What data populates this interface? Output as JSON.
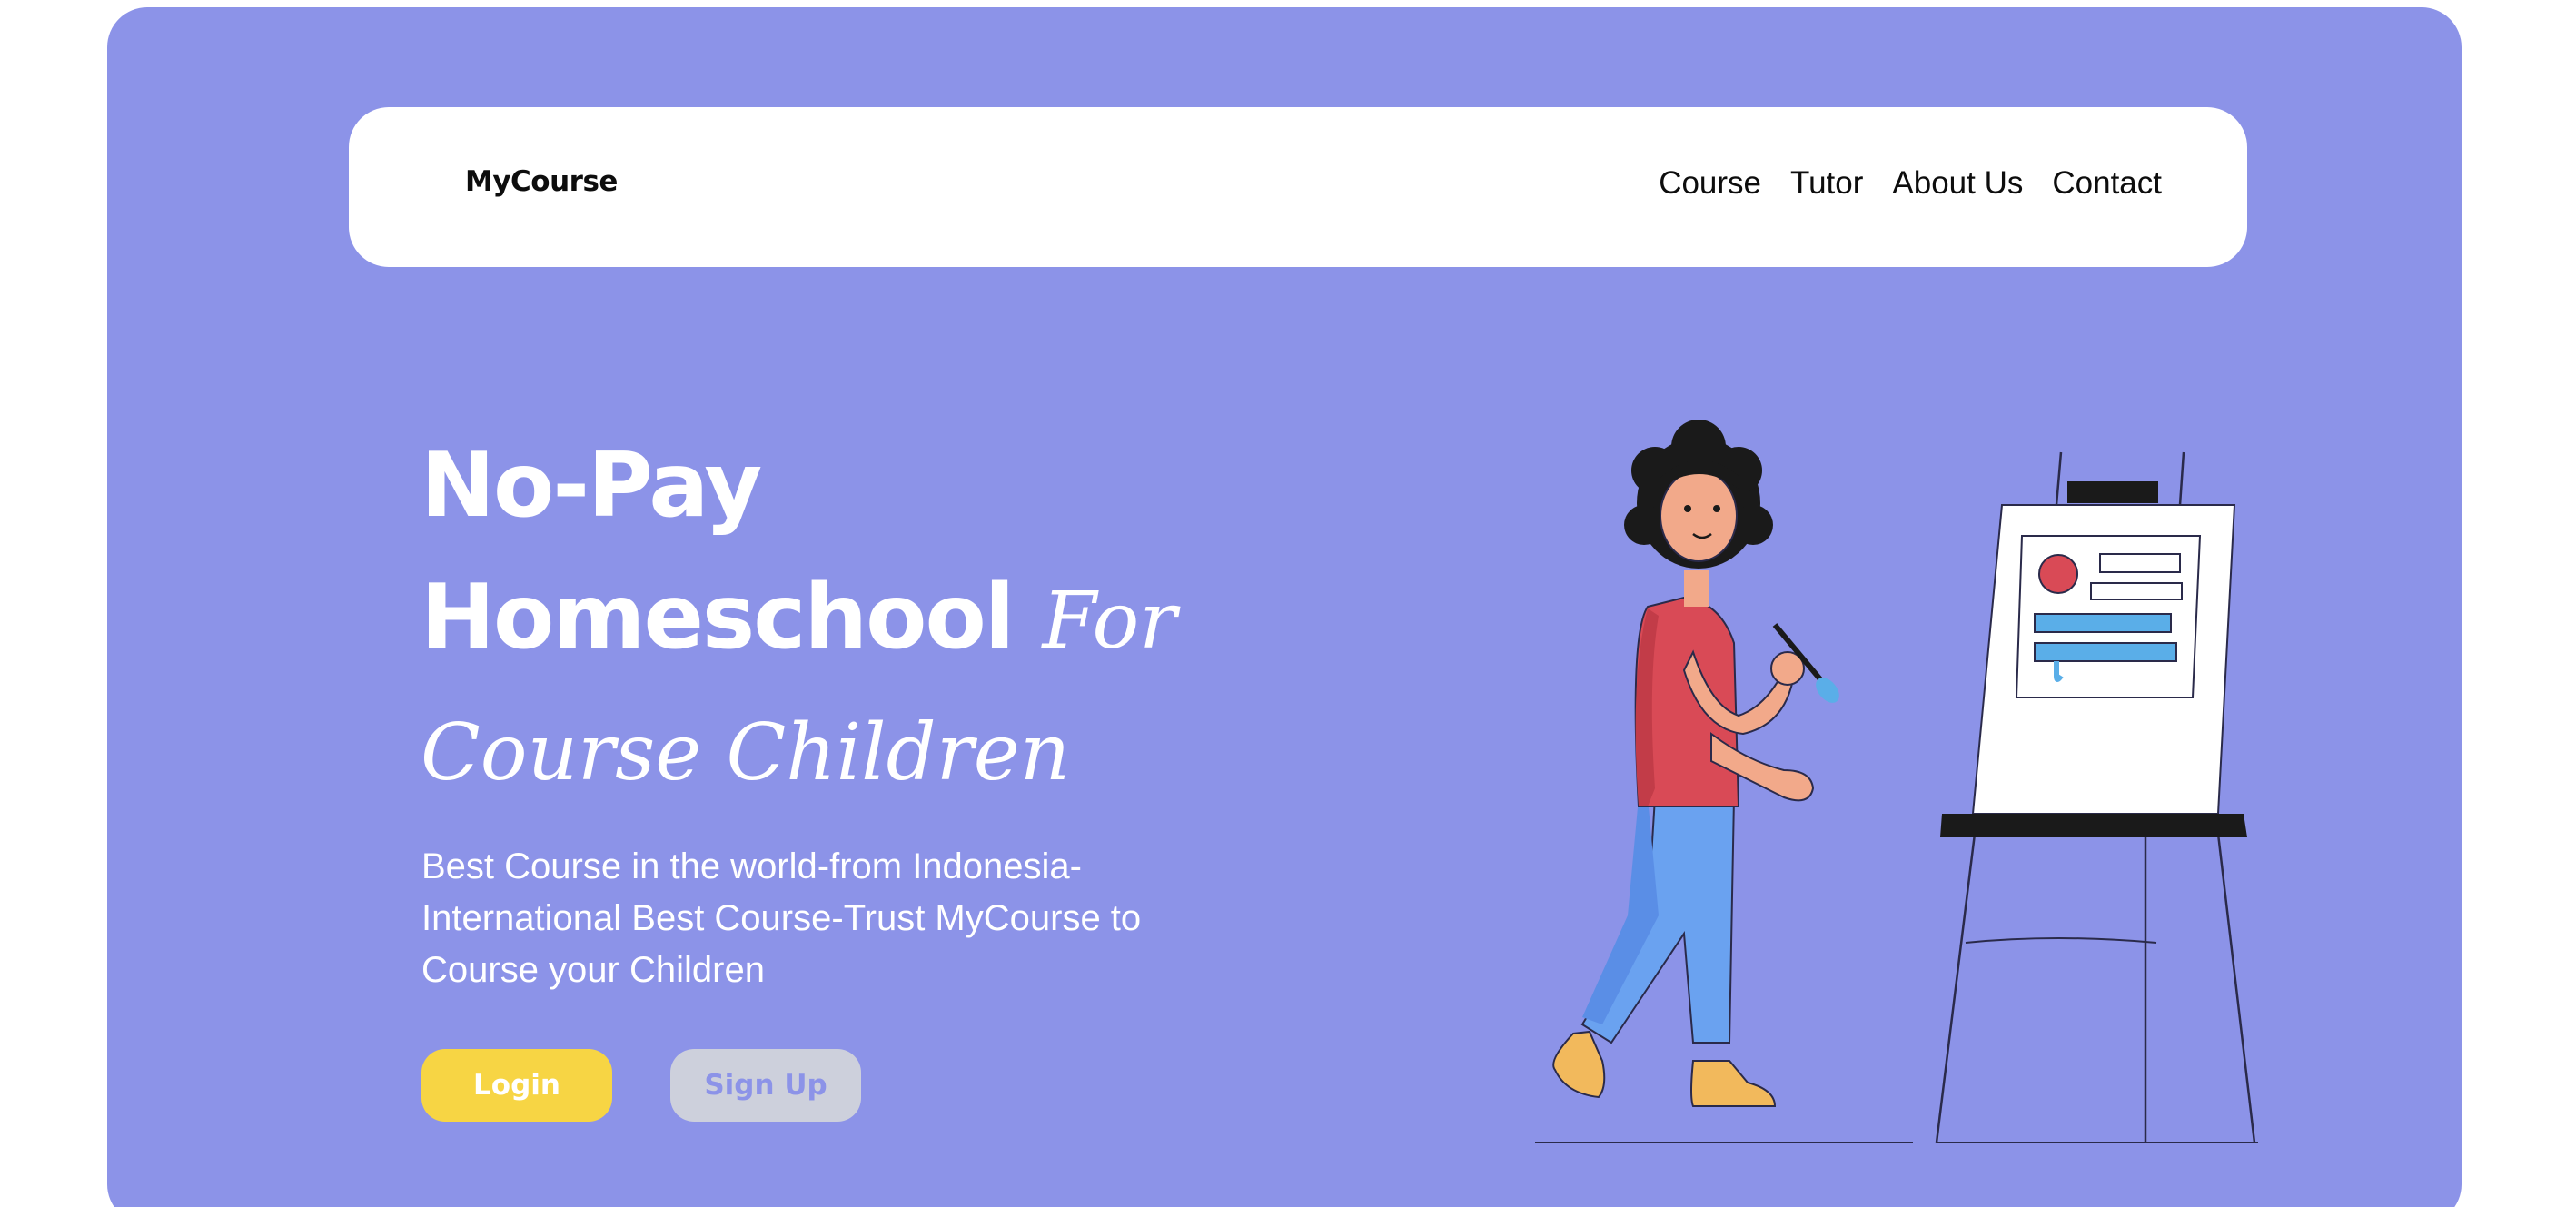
{
  "brand": {
    "name": "MyCourse"
  },
  "nav": {
    "items": [
      {
        "label": "Course"
      },
      {
        "label": "Tutor"
      },
      {
        "label": "About Us"
      },
      {
        "label": "Contact"
      }
    ]
  },
  "hero": {
    "headline_line1": "No-Pay",
    "headline_line2_bold": "Homeschool",
    "headline_line2_italic": "For",
    "headline_line3_italic": "Course Children",
    "subtext": "Best Course in the world-from Indonesia-International Best Course-Trust MyCourse to Course your Children",
    "login_label": "Login",
    "signup_label": "Sign Up"
  },
  "colors": {
    "background": "#8c93e8",
    "navbar": "#ffffff",
    "login_button": "#f7d544",
    "signup_button": "#cdd0dc"
  },
  "illustration": {
    "icon": "child-painting-easel-illustration"
  }
}
